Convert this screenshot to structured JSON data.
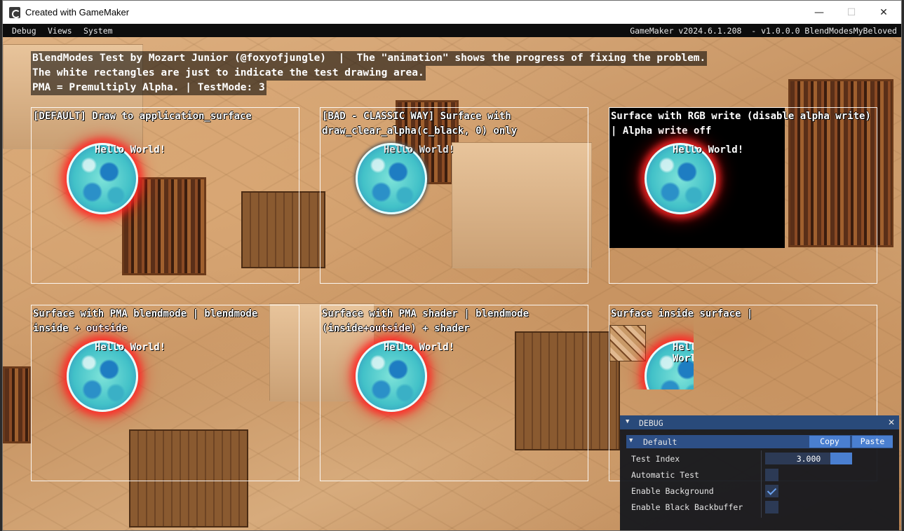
{
  "window": {
    "title": "Created with GameMaker"
  },
  "menubar": {
    "items": [
      "Debug",
      "Views",
      "System"
    ],
    "right_text": "GameMaker v2024.6.1.208  - v1.0.0.0 BlendModesMyBeloved"
  },
  "info": {
    "line1": "BlendModes Test by Mozart Junior (@foxyofjungle)  |  The \"animation\" shows the progress of fixing the problem.",
    "line2": "The white rectangles are just to indicate the test drawing area.",
    "line3": "PMA = Premultiply Alpha. | TestMode: 3"
  },
  "panels": [
    {
      "label": "[DEFAULT] Draw to application_surface",
      "hello": "Hello World!"
    },
    {
      "label": "[BAD - CLASSIC WAY] Surface with draw_clear_alpha(c_black, 0) only",
      "hello": "Hello World!"
    },
    {
      "label": "Surface with RGB write (disable alpha write) | Alpha write off",
      "hello": "Hello World!"
    },
    {
      "label": "Surface with PMA blendmode | blendmode inside + outside",
      "hello": "Hello World!"
    },
    {
      "label": "Surface with PMA shader | blendmode (inside+outside) + shader",
      "hello": "Hello World!"
    },
    {
      "label": "Surface inside surface |",
      "hello": "Hello World!"
    }
  ],
  "debug": {
    "title": "DEBUG",
    "section": "Default",
    "copy_label": "Copy",
    "paste_label": "Paste",
    "rows": [
      "Test Index",
      "Automatic Test",
      "Enable Background",
      "Enable Black Backbuffer"
    ],
    "test_index_value": "3.000",
    "automatic_test": false,
    "enable_background": true,
    "enable_black_backbuffer": false
  }
}
